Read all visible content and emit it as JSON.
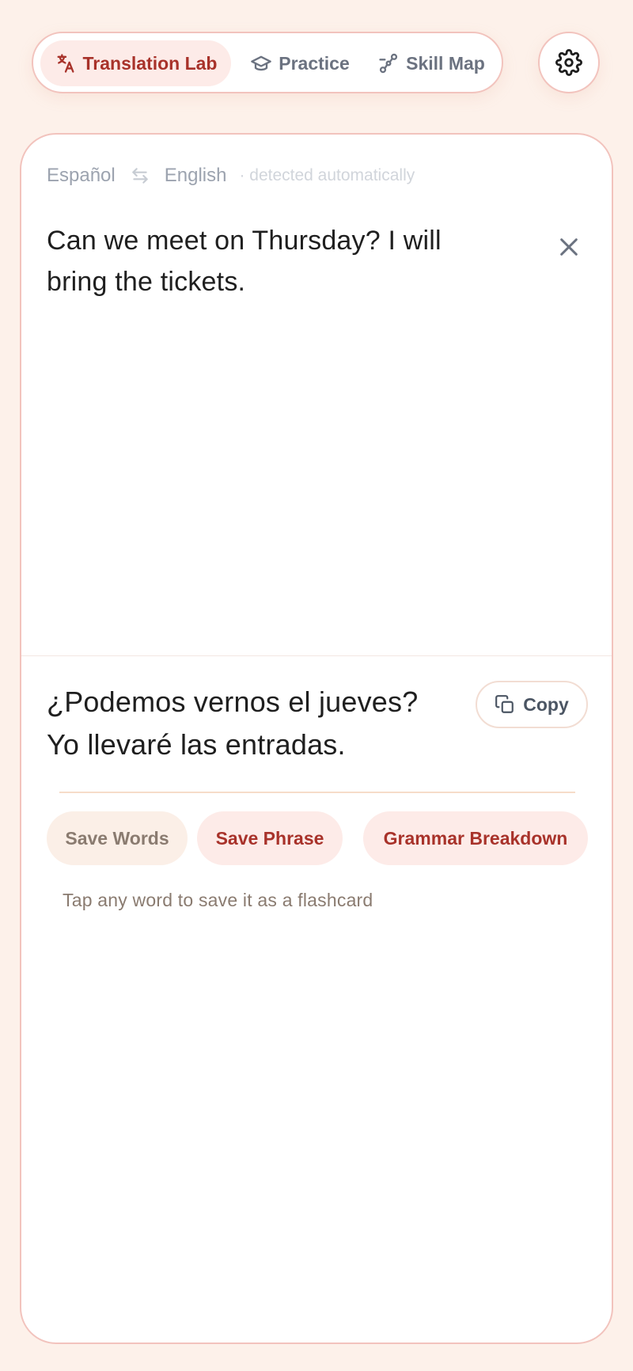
{
  "nav": {
    "tabs": [
      {
        "label": "Translation Lab",
        "icon": "translate-icon",
        "active": true
      },
      {
        "label": "Practice",
        "icon": "graduation-cap-icon",
        "active": false
      },
      {
        "label": "Skill Map",
        "icon": "route-icon",
        "active": false
      }
    ],
    "settings_icon": "gear-icon"
  },
  "translator": {
    "source_lang": "Español",
    "target_lang": "English",
    "detected_note": "· detected automatically",
    "source_text": "Can we meet on Thursday? I will bring the tickets.",
    "translated_text": "¿Podemos vernos el jueves? Yo llevaré las entradas.",
    "copy_label": "Copy"
  },
  "actions": {
    "save_words": "Save Words",
    "save_phrase": "Save Phrase",
    "grammar_breakdown": "Grammar Breakdown"
  },
  "hint": "Tap any word to save it as a flashcard",
  "colors": {
    "background": "#fdf1ea",
    "accent": "#a8322a",
    "accent_soft": "#fdebe8",
    "border": "#f2c3bd",
    "muted": "#6b7280"
  }
}
